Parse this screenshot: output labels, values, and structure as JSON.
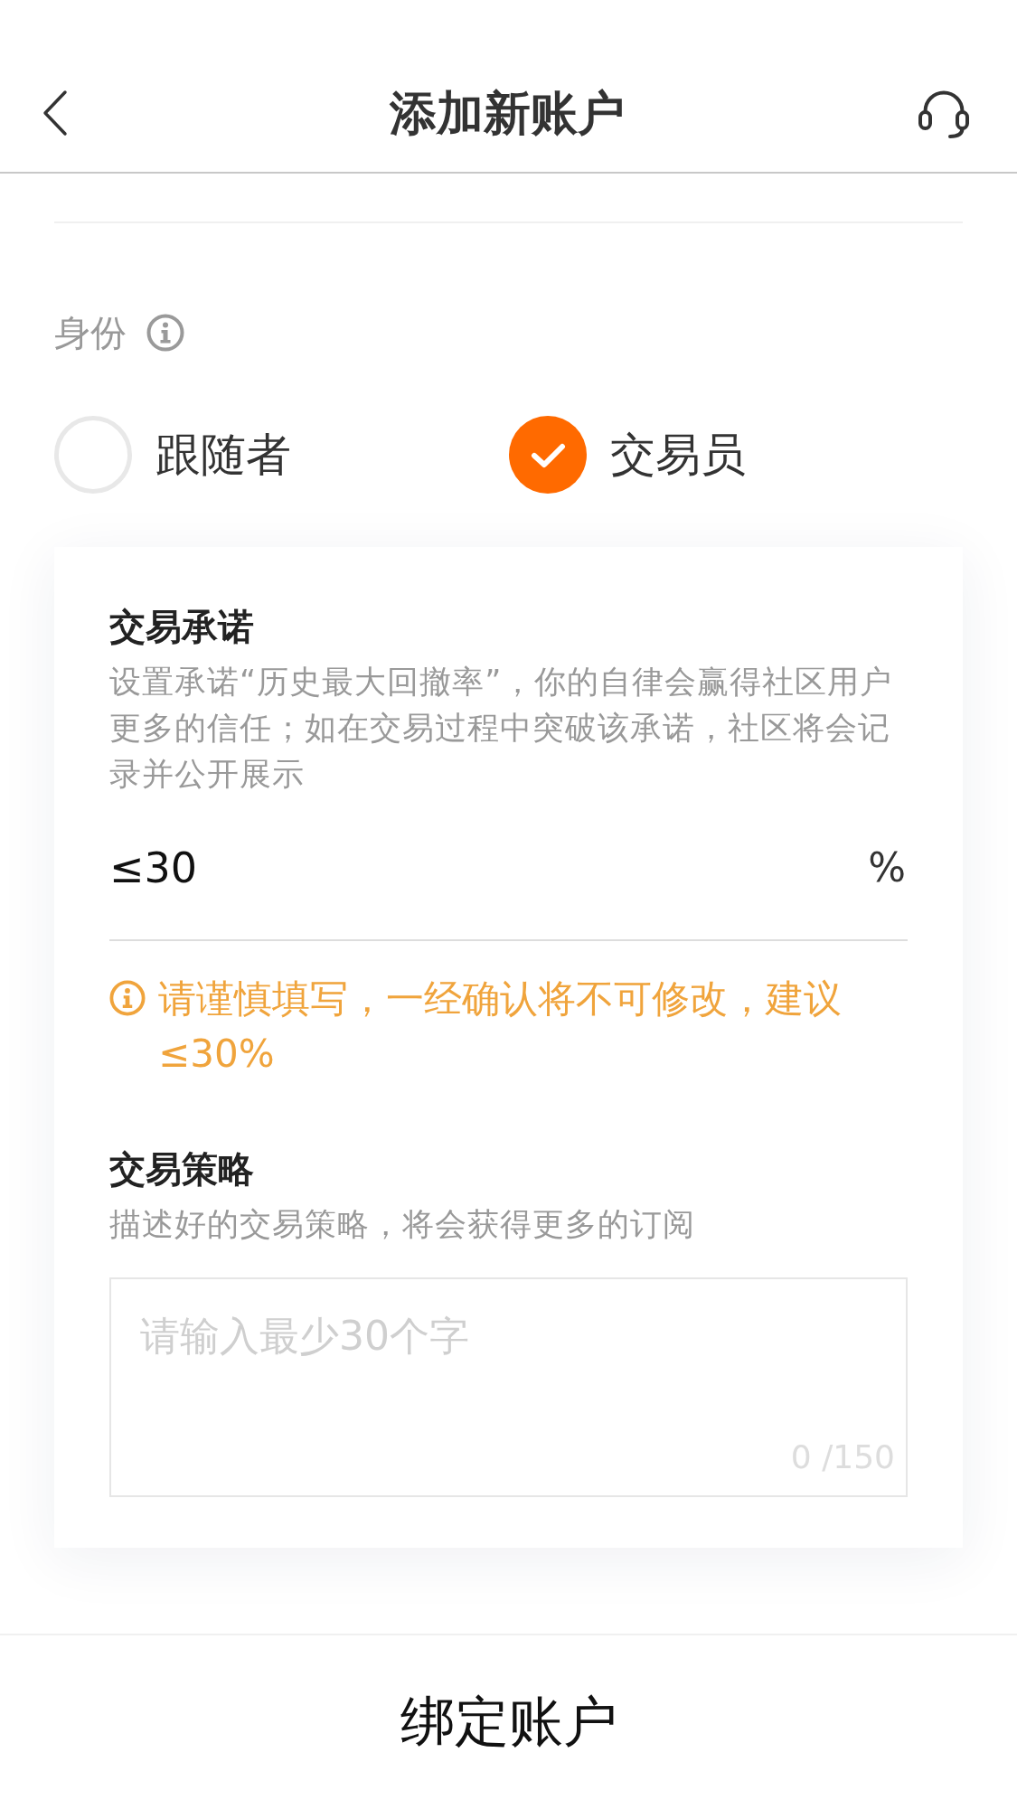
{
  "header": {
    "title": "添加新账户"
  },
  "identity": {
    "label": "身份",
    "options": [
      {
        "label": "跟随者",
        "selected": false
      },
      {
        "label": "交易员",
        "selected": true
      }
    ]
  },
  "commitment": {
    "title": "交易承诺",
    "description": "设置承诺“历史最大回撤率”，你的自律会赢得社区用户更多的信任；如在交易过程中突破该承诺，社区将会记录并公开展示",
    "value": "≤30",
    "unit": "%",
    "warning": "请谨慎填写，一经确认将不可修改，建议≤30%"
  },
  "strategy": {
    "title": "交易策略",
    "description": "描述好的交易策略，将会获得更多的订阅",
    "placeholder": "请输入最少30个字",
    "counter": "0 /150"
  },
  "submit": {
    "label": "绑定账户"
  }
}
